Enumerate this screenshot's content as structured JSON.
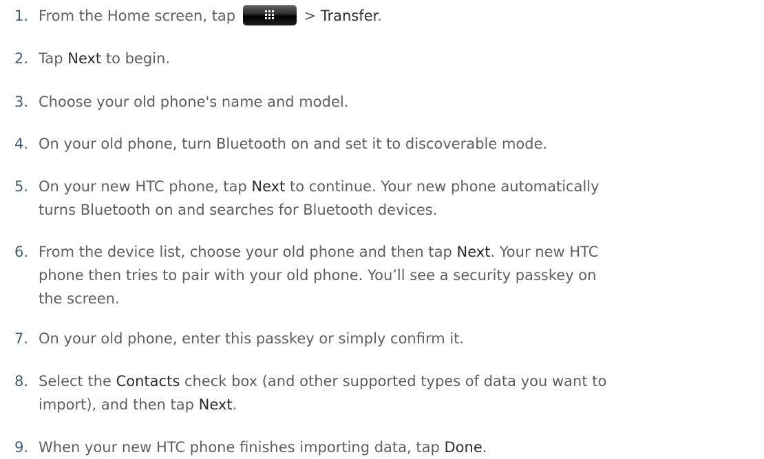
{
  "steps": [
    {
      "number": "1.",
      "lines": [
        [
          "From the Home screen, tap ",
          {
            "icon": "all-apps-button"
          },
          " > ",
          {
            "ui": "Transfer"
          },
          "."
        ]
      ]
    },
    {
      "number": "2.",
      "lines": [
        [
          "Tap ",
          {
            "ui": "Next"
          },
          " to begin."
        ]
      ]
    },
    {
      "number": "3.",
      "lines": [
        [
          "Choose your old phone's name and model."
        ]
      ]
    },
    {
      "number": "4.",
      "lines": [
        [
          "On your old phone, turn Bluetooth on and set it to discoverable mode."
        ]
      ]
    },
    {
      "number": "5.",
      "lines": [
        [
          "On your new HTC phone, tap ",
          {
            "ui": "Next"
          },
          " to continue. Your new phone automatically"
        ],
        [
          "turns Bluetooth on and searches for Bluetooth devices."
        ]
      ]
    },
    {
      "number": "6.",
      "lines": [
        [
          "From the device list, choose your old phone and then tap ",
          {
            "ui": "Next"
          },
          ". Your new HTC"
        ],
        [
          "phone then tries to pair with your old phone. You’ll see a security passkey on"
        ],
        [
          "the screen."
        ]
      ]
    },
    {
      "number": "7.",
      "lines": [
        [
          "On your old phone, enter this passkey or simply confirm it."
        ]
      ]
    },
    {
      "number": "8.",
      "lines": [
        [
          "Select the ",
          {
            "ui": "Contacts"
          },
          " check box (and other supported types of data you want to"
        ],
        [
          "import), and then tap ",
          {
            "ui": "Next"
          },
          "."
        ]
      ]
    },
    {
      "number": "9.",
      "lines": [
        [
          "When your new HTC phone finishes importing data, tap ",
          {
            "ui": "Done"
          },
          "."
        ]
      ]
    }
  ]
}
